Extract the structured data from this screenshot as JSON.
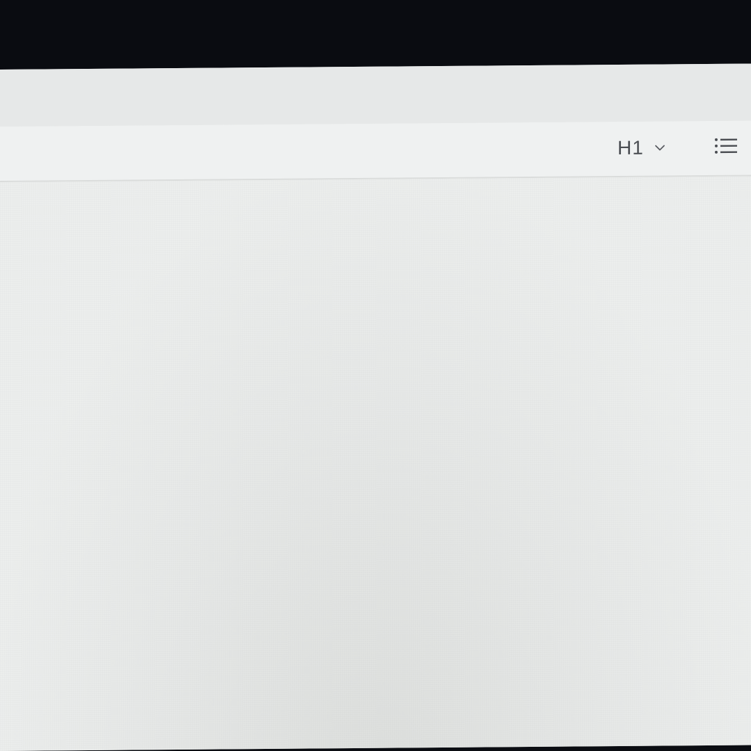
{
  "toolbar": {
    "heading_selector": {
      "value": "H1",
      "icon": "chevron-down-icon"
    },
    "list_button": {
      "icon": "bulleted-list-icon"
    }
  },
  "editor": {
    "content": ""
  }
}
